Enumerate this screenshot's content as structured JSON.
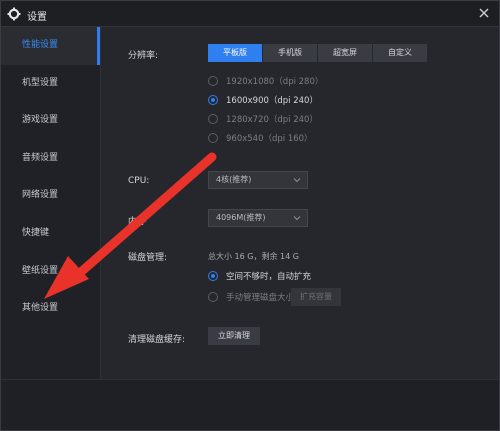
{
  "window": {
    "title": "设置"
  },
  "sidebar": {
    "items": [
      {
        "label": "性能设置",
        "active": true
      },
      {
        "label": "机型设置"
      },
      {
        "label": "游戏设置"
      },
      {
        "label": "音频设置"
      },
      {
        "label": "网络设置"
      },
      {
        "label": "快捷键"
      },
      {
        "label": "壁纸设置"
      },
      {
        "label": "其他设置"
      }
    ]
  },
  "resolution": {
    "label": "分辨率:",
    "modes": [
      "平板版",
      "手机版",
      "超宽屏",
      "自定义"
    ],
    "active_mode": "平板版",
    "options": [
      {
        "label": "1920x1080（dpi 280）",
        "selected": false
      },
      {
        "label": "1600x900（dpi 240）",
        "selected": true
      },
      {
        "label": "1280x720（dpi 240）",
        "selected": false
      },
      {
        "label": "960x540（dpi 160）",
        "selected": false
      }
    ]
  },
  "cpu": {
    "label": "CPU:",
    "value": "4核(推荐)"
  },
  "memory": {
    "label": "内存",
    "value": "4096M(推荐)"
  },
  "disk": {
    "label": "磁盘管理:",
    "info": "总大小 16 G，剩余 14 G",
    "options": [
      {
        "label": "空间不够时，自动扩充",
        "selected": true
      },
      {
        "label": "手动管理磁盘大小",
        "selected": false
      }
    ],
    "expand_button": "扩充容量"
  },
  "cache": {
    "label": "清理磁盘缓存:",
    "button": "立即清理"
  },
  "colors": {
    "accent": "#2f7fee",
    "arrow": "#e8322a"
  }
}
